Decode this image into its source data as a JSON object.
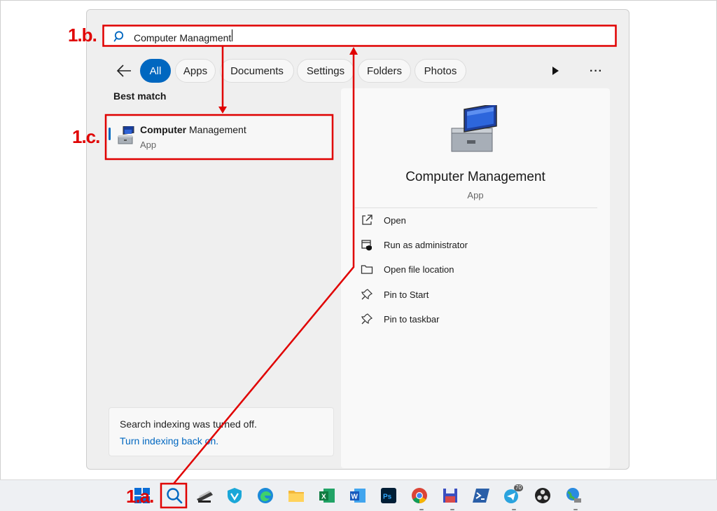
{
  "search": {
    "value": "Computer Managment"
  },
  "filters": {
    "back_label": "",
    "chips": [
      "All",
      "Apps",
      "Documents",
      "Settings",
      "Folders",
      "Photos"
    ]
  },
  "best_match": {
    "heading": "Best match",
    "result": {
      "title_bold": "Computer",
      "title_rest": " Management",
      "subtitle": "App"
    }
  },
  "indexing": {
    "message": "Search indexing was turned off.",
    "link": "Turn indexing back on."
  },
  "detail": {
    "title": "Computer Management",
    "subtitle": "App",
    "actions": [
      "Open",
      "Run as administrator",
      "Open file location",
      "Pin to Start",
      "Pin to taskbar"
    ]
  },
  "taskbar": {
    "telegram_badge": "70"
  },
  "annotations": {
    "step_a": "1.a.",
    "step_b": "1.b.",
    "step_c": "1.c."
  },
  "colors": {
    "accent": "#0067c0",
    "annotation": "#e00000"
  }
}
